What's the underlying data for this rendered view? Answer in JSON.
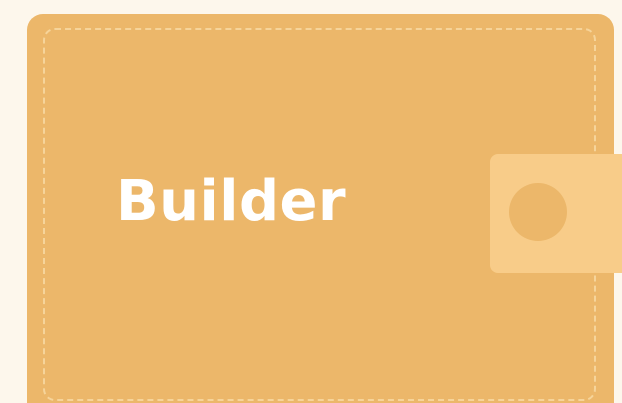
{
  "wallet": {
    "label": "Builder"
  },
  "icons": {
    "clasp": "wallet-clasp-icon",
    "button": "snap-button-icon"
  },
  "colors": {
    "background": "#fdf7ec",
    "wallet": "#ecb76a",
    "stitch": "#f6d49a",
    "clasp": "#f8cc89",
    "label": "#ffffff"
  }
}
